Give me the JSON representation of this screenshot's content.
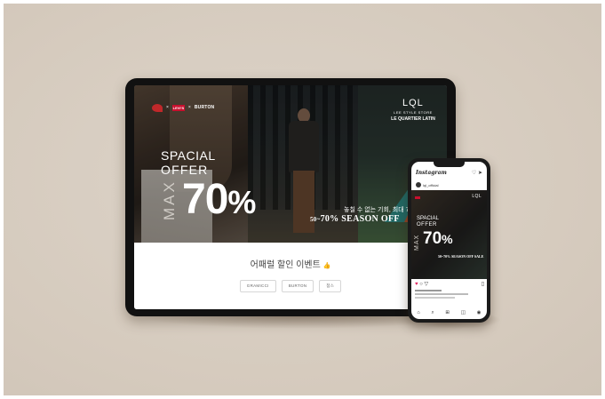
{
  "tablet": {
    "brands": {
      "levis": "LEVI'S",
      "x": "×",
      "burton": "BURTON"
    },
    "hero": {
      "spacial": "SPACIAL",
      "offer": "OFFER",
      "max": "MAX",
      "big_number": "70",
      "percent": "%",
      "korean_tagline": "놓칠 수 없는 기회, 최대 70%",
      "season_prefix": "50",
      "season_text": "70% SEASON OFF",
      "lql": "LQL",
      "lql_sub1": "LEE STYLE STORE",
      "lql_sub2": "LE QUARTIER LATIN"
    },
    "event_title": "어패럴 할인 이벤트",
    "tags": [
      "GRAMICCI",
      "BURTON",
      "참스"
    ]
  },
  "phone": {
    "app_name": "Instagram",
    "username": "lql_official",
    "post": {
      "lql": "LQL",
      "spacial": "SPACIAL",
      "offer": "OFFER",
      "max": "MAX",
      "big_number": "70",
      "percent": "%",
      "season": "50~70% SEASON OFF SALE"
    }
  },
  "colors": {
    "background": "#d9cfc3",
    "device": "#111111",
    "levis_red": "#c8102e",
    "heart": "#e0245e"
  }
}
